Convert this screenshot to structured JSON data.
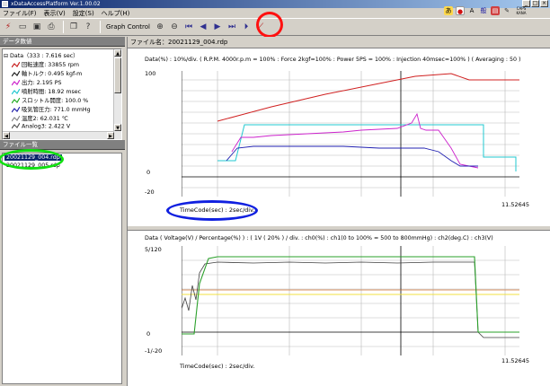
{
  "window": {
    "title": "xDataAccessPlatform Ver.1.00.02",
    "controls": {
      "minimize": "_",
      "maximize": "□",
      "close": "×"
    }
  },
  "menu": [
    "ファイル(F)",
    "表示(V)",
    "設定(S)",
    "ヘルプ(H)"
  ],
  "toolbar": {
    "graph_control_label": "Graph Control",
    "buttons": [
      "connect-icon",
      "open-icon",
      "save-icon",
      "print-icon",
      "copy-icon",
      "zoom-in-icon",
      "zoom-out-icon",
      "first-icon",
      "prev-icon",
      "play-icon",
      "next-icon",
      "last-icon",
      "graph-icon"
    ]
  },
  "tray": {
    "caps": "CAPS",
    "kana": "KANA"
  },
  "left": {
    "data_header": "データ数値",
    "data_root": "Data（333 : 7.616 sec）",
    "channels": [
      {
        "label": "回転速度: 33855 rpm",
        "color": "#c81e1e"
      },
      {
        "label": "軸トルク: 0.495 kgf-m",
        "color": "#1e1e1e"
      },
      {
        "label": "出力: 2.195 PS",
        "color": "#cc22cc"
      },
      {
        "label": "噴射時間: 18.92 msec",
        "color": "#21c8d0"
      },
      {
        "label": "スロットル開度: 100.0 %",
        "color": "#22aa22"
      },
      {
        "label": "吸気管圧力: 771.0 mmHg",
        "color": "#2222aa"
      },
      {
        "label": "温度2: 62.031 ℃",
        "color": "#888888"
      },
      {
        "label": "Analog3: 2.422 V",
        "color": "#555555"
      }
    ],
    "files_header": "ファイル一覧",
    "files": [
      "20021129_004.rdp",
      "20021129_005.rdp"
    ]
  },
  "main": {
    "file_label": "ファイル名：20021129_004.rdp",
    "graph1": {
      "title": "Data(%) : 10%/div. ( R.P.M. 4000r.p.m = 100% : Force 2kgf=100% : Power 5PS = 100% : Injection 40msec=100% ) ( Averaging : 50 )",
      "y_max": "100",
      "y_zero": "0",
      "y_min": "-20",
      "x_label": "TimeCode(sec) : 2sec/div.",
      "x_end": "11.52645"
    },
    "graph2": {
      "title": "Data ( Voltage(V) / Percentage(%) ) : ( 1V ( 20% ) / div. : ch0(%) : ch1(0 to 100% = 500 to 800mmHg) : ch2(deg.C) : ch3(V)",
      "y_max": "5/120",
      "y_zero": "0",
      "y_min": "-1/-20",
      "x_label": "TimeCode(sec) : 2sec/div.",
      "x_end": "11.52645"
    }
  },
  "colors": {
    "highlight_red": "#ff1010",
    "highlight_green": "#10e010",
    "highlight_blue": "#1020e0"
  }
}
